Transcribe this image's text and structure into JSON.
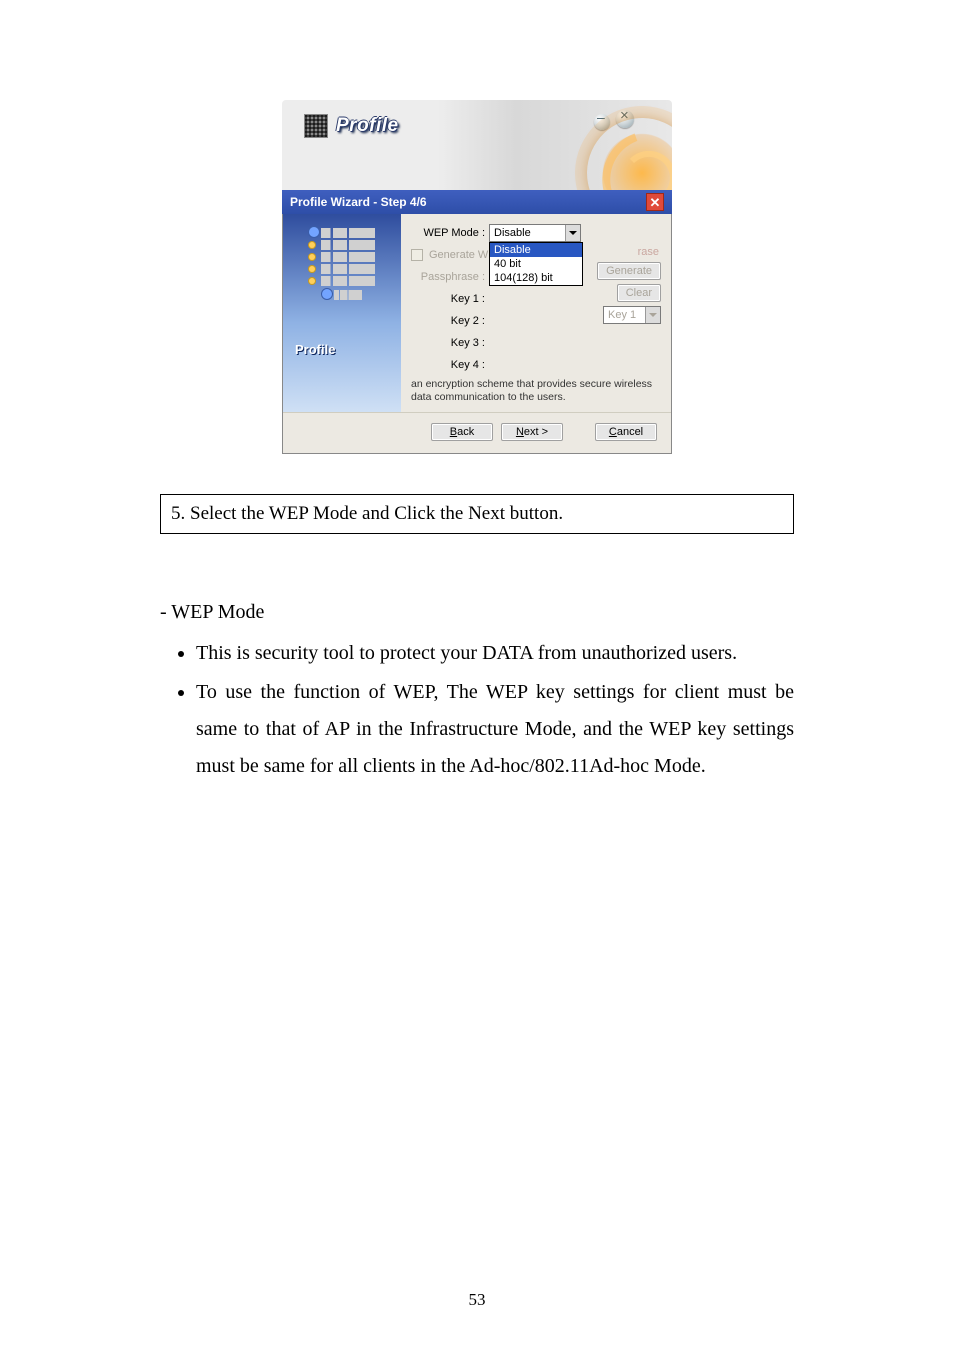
{
  "screenshot": {
    "banner_title": "Profile",
    "wizard_title": "Profile Wizard - Step 4/6",
    "left_label": "Profile",
    "labels": {
      "wep_mode": "WEP Mode :",
      "gen_check": "Generate W",
      "passphrase": "Passphrase :",
      "key1": "Key 1 :",
      "key2": "Key 2 :",
      "key3": "Key 3 :",
      "key4": "Key 4 :",
      "rase": "rase"
    },
    "wep_select_value": "Disable",
    "dropdown": {
      "opt_sel": "Disable",
      "opt2": "40 bit",
      "opt3": "104(128) bit"
    },
    "buttons": {
      "generate": "Generate",
      "clear": "Clear",
      "keysel": "Key 1",
      "back": "Back",
      "next": "Next >",
      "cancel": "Cancel"
    },
    "info_text": "an encryption scheme that provides secure wireless data communication to the users."
  },
  "caption": "5. Select the WEP Mode and Click the Next button.",
  "body": {
    "heading": "- WEP Mode",
    "b1": "This is security tool to protect your DATA from unauthorized users.",
    "b2": "To use the function of WEP, The WEP key settings for client must be same to that of AP in the Infrastructure Mode, and the WEP key settings must be same for all clients in the Ad-hoc/802.11Ad-hoc Mode."
  },
  "page_number": "53"
}
